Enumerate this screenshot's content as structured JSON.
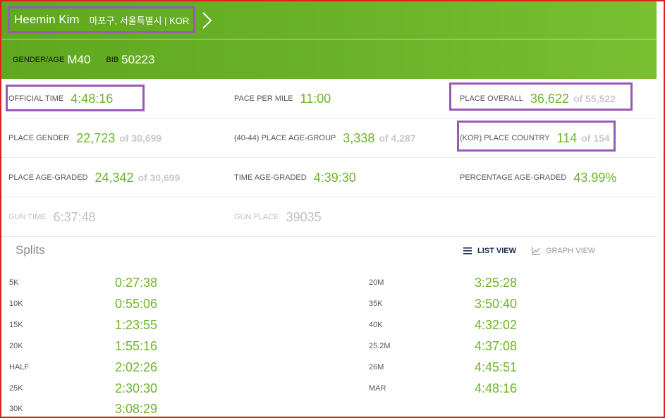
{
  "header": {
    "runner_name": "Heemin Kim",
    "location": "마포구, 서울특별시 | KOR",
    "gender_age_label": "GENDER/AGE",
    "gender_age": "M40",
    "bib_label": "BIB",
    "bib": "50223"
  },
  "stats": [
    [
      {
        "label": "OFFICIAL TIME",
        "value": "4:48:16",
        "of": ""
      },
      {
        "label": "PACE PER MILE",
        "value": "11:00",
        "of": ""
      },
      {
        "label": "PLACE OVERALL",
        "value": "36,622",
        "of": "of 55,522"
      }
    ],
    [
      {
        "label": "PLACE GENDER",
        "value": "22,723",
        "of": "of 30,699"
      },
      {
        "label": "(40-44) PLACE AGE-GROUP",
        "value": "3,338",
        "of": "of 4,287"
      },
      {
        "label": "(KOR) PLACE COUNTRY",
        "value": "114",
        "of": "of 154"
      }
    ],
    [
      {
        "label": "PLACE AGE-GRADED",
        "value": "24,342",
        "of": "of 30,699"
      },
      {
        "label": "TIME AGE-GRADED",
        "value": "4:39:30",
        "of": ""
      },
      {
        "label": "PERCENTAGE AGE-GRADED",
        "value": "43.99%",
        "of": ""
      }
    ],
    [
      {
        "label": "GUN TIME",
        "value": "6:37:48",
        "of": ""
      },
      {
        "label": "GUN PLACE",
        "value": "39035",
        "of": ""
      }
    ]
  ],
  "splits": {
    "title": "Splits",
    "list_view_label": "LIST VIEW",
    "graph_view_label": "GRAPH VIEW",
    "left": [
      {
        "label": "5K",
        "time": "0:27:38"
      },
      {
        "label": "10K",
        "time": "0:55:06"
      },
      {
        "label": "15K",
        "time": "1:23:55"
      },
      {
        "label": "20K",
        "time": "1:55:16"
      },
      {
        "label": "HALF",
        "time": "2:02:26"
      },
      {
        "label": "25K",
        "time": "2:30:30"
      },
      {
        "label": "30K",
        "time": "3:08:29"
      }
    ],
    "right": [
      {
        "label": "20M",
        "time": "3:25:28"
      },
      {
        "label": "35K",
        "time": "3:50:40"
      },
      {
        "label": "40K",
        "time": "4:32:02"
      },
      {
        "label": "25.2M",
        "time": "4:37:08"
      },
      {
        "label": "26M",
        "time": "4:45:51"
      },
      {
        "label": "MAR",
        "time": "4:48:16"
      }
    ]
  },
  "colors": {
    "accent_green": "#6cb52a",
    "highlight_purple": "#9b59b6",
    "border_red": "#e02020"
  }
}
